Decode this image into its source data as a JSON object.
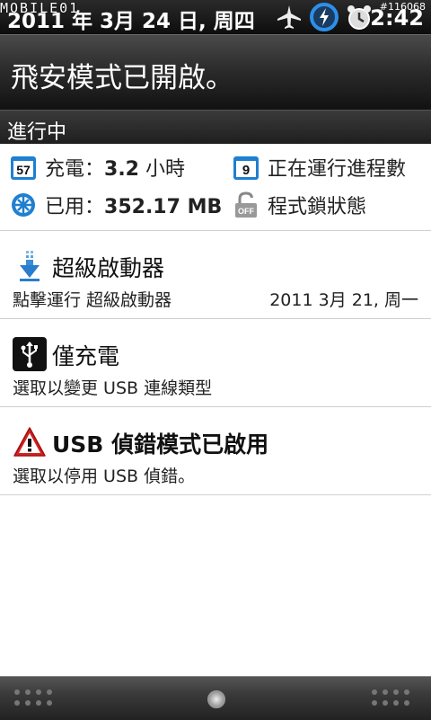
{
  "status_bar": {
    "date": "2011 年 3月 24 日, 周四",
    "watermark": "MOBILE01",
    "time": "2:42",
    "id_label": "#116068",
    "icons": [
      "airplane-icon",
      "sync-icon",
      "alarm-icon"
    ]
  },
  "header": {
    "title": "飛安模式已開啟。"
  },
  "section": {
    "title": "進行中"
  },
  "info": {
    "battery": {
      "badge": "57",
      "label": "充電：",
      "value": "3.2",
      "unit": " 小時"
    },
    "processes": {
      "badge": "9",
      "label": "正在運行進程數"
    },
    "memory": {
      "label": "已用：",
      "value": "352.17 MB"
    },
    "lock": {
      "badge": "OFF",
      "label": "程式鎖狀態"
    }
  },
  "notifications": [
    {
      "title": "超級啟動器",
      "subtitle": "點擊運行 超級啟動器",
      "time": "2011 3月 21, 周一",
      "icon": "download-arrow-icon"
    },
    {
      "title": "僅充電",
      "subtitle": "選取以變更 USB 連線類型",
      "time": "",
      "icon": "usb-icon"
    },
    {
      "title": "USB 偵錯模式已啟用",
      "subtitle": "選取以停用 USB 偵錯。",
      "time": "",
      "icon": "warning-icon"
    }
  ],
  "colors": {
    "accent_blue": "#1f7fd0",
    "warning_red": "#d42020",
    "header_dark": "#2c2c2c"
  }
}
